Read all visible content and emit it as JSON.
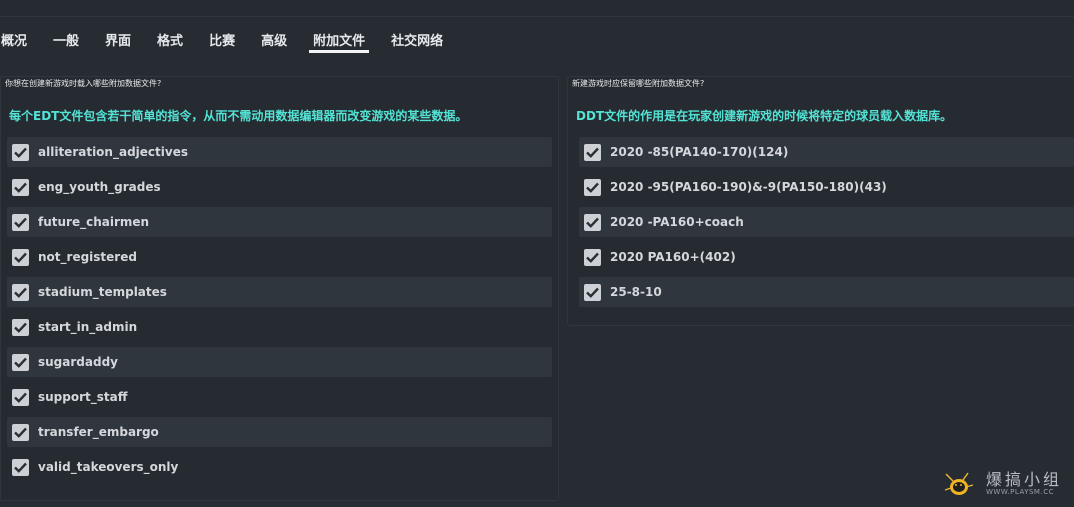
{
  "tabs": [
    {
      "label": "概况",
      "active": false
    },
    {
      "label": "一般",
      "active": false
    },
    {
      "label": "界面",
      "active": false
    },
    {
      "label": "格式",
      "active": false
    },
    {
      "label": "比赛",
      "active": false
    },
    {
      "label": "高级",
      "active": false
    },
    {
      "label": "附加文件",
      "active": true
    },
    {
      "label": "社交网络",
      "active": false
    }
  ],
  "left_panel": {
    "question": "你想在创建新游戏时载入哪些附加数据文件?",
    "description": "每个EDT文件包含若干简单的指令，从而不需动用数据编辑器而改变游戏的某些数据。",
    "items": [
      {
        "label": "alliteration_adjectives",
        "checked": true
      },
      {
        "label": "eng_youth_grades",
        "checked": true
      },
      {
        "label": "future_chairmen",
        "checked": true
      },
      {
        "label": "not_registered",
        "checked": true
      },
      {
        "label": "stadium_templates",
        "checked": true
      },
      {
        "label": "start_in_admin",
        "checked": true
      },
      {
        "label": "sugardaddy",
        "checked": true
      },
      {
        "label": "support_staff",
        "checked": true
      },
      {
        "label": "transfer_embargo",
        "checked": true
      },
      {
        "label": "valid_takeovers_only",
        "checked": true
      }
    ]
  },
  "right_panel": {
    "question": "新建游戏时应保留哪些附加数据文件?",
    "description": "DDT文件的作用是在玩家创建新游戏的时候将特定的球员载入数据库。",
    "items": [
      {
        "label": "2020 -85(PA140-170)(124)",
        "checked": true
      },
      {
        "label": "2020 -95(PA160-190)&-9(PA150-180)(43)",
        "checked": true
      },
      {
        "label": "2020 -PA160+coach",
        "checked": true
      },
      {
        "label": "2020 PA160+(402)",
        "checked": true
      },
      {
        "label": "25-8-10",
        "checked": true
      }
    ]
  },
  "watermark": {
    "cn_text": "爆搞小组",
    "url_text": "WWW.PLAYSM.CC",
    "logo_icon": "bug-logo-icon"
  },
  "colors": {
    "background": "#272c33",
    "accent_text": "#53e3d5",
    "checkbox_fill": "#cdd1d5",
    "row_alt": "#30363d"
  }
}
